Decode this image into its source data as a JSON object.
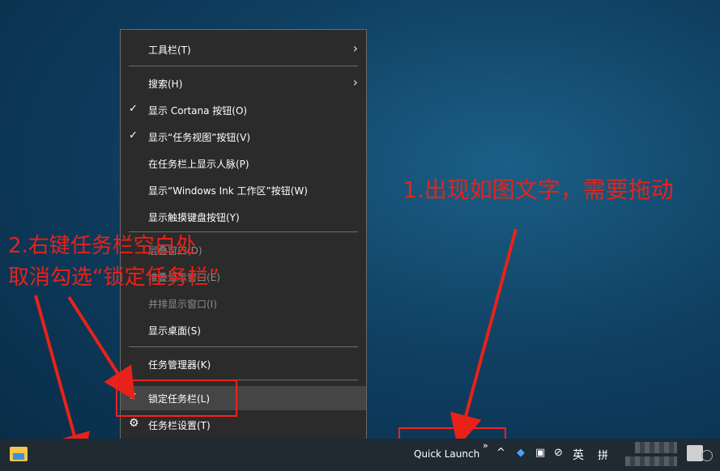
{
  "menu": {
    "items": [
      {
        "label": "工具栏(T)"
      },
      {
        "label": "搜索(H)"
      },
      {
        "label": "显示 Cortana 按钮(O)"
      },
      {
        "label": "显示“任务视图”按钮(V)"
      },
      {
        "label": "在任务栏上显示人脉(P)"
      },
      {
        "label": "显示“Windows Ink 工作区”按钮(W)"
      },
      {
        "label": "显示触摸键盘按钮(Y)"
      },
      {
        "label": "层叠窗口(D)"
      },
      {
        "label": "堆叠显示窗口(E)"
      },
      {
        "label": "并排显示窗口(I)"
      },
      {
        "label": "显示桌面(S)"
      },
      {
        "label": "任务管理器(K)"
      },
      {
        "label": "锁定任务栏(L)"
      },
      {
        "label": "任务栏设置(T)"
      }
    ]
  },
  "annotations": {
    "step1": "1.出现如图文字，需要拖动",
    "step2_line1": "2.右键任务栏空白处",
    "step2_line2": "取消勾选“锁定任务栏”"
  },
  "taskbar": {
    "quick_launch": "Quick Launch",
    "more": "»",
    "chevron": "^",
    "ime": "英",
    "ime2": "拼"
  },
  "colors": {
    "annotation": "#e8221a",
    "menu_bg": "#2b2b2b",
    "taskbar_bg": "#1f2a33"
  },
  "icons": [
    "check-icon",
    "chevron-right-icon",
    "gear-icon",
    "file-explorer-icon",
    "defender-icon",
    "network-icon",
    "volume-muted-icon",
    "notification-icon"
  ]
}
